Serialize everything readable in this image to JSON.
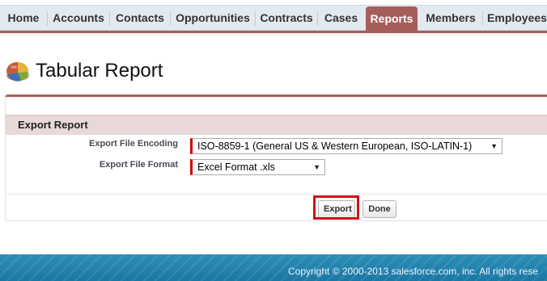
{
  "tabs": [
    {
      "label": "Home",
      "active": false
    },
    {
      "label": "Accounts",
      "active": false
    },
    {
      "label": "Contacts",
      "active": false
    },
    {
      "label": "Opportunities",
      "active": false
    },
    {
      "label": "Contracts",
      "active": false
    },
    {
      "label": "Cases",
      "active": false
    },
    {
      "label": "Reports",
      "active": true
    },
    {
      "label": "Members",
      "active": false
    },
    {
      "label": "Employees",
      "active": false
    }
  ],
  "page": {
    "title": "Tabular Report",
    "icon": "report-pie-chart-icon"
  },
  "export_section": {
    "title": "Export Report",
    "encoding_label": "Export File Encoding",
    "encoding_value": "ISO-8859-1 (General US & Western European, ISO-LATIN-1)",
    "format_label": "Export File Format",
    "format_value": "Excel Format .xls"
  },
  "buttons": {
    "export": "Export",
    "done": "Done"
  },
  "footer": {
    "copyright": "Copyright © 2000-2013 salesforce.com, inc. All rights rese"
  },
  "colors": {
    "accent": "#a65e5a",
    "required_marker": "#cc0000",
    "highlight": "#d0101a",
    "footer": "#1b77a3"
  }
}
